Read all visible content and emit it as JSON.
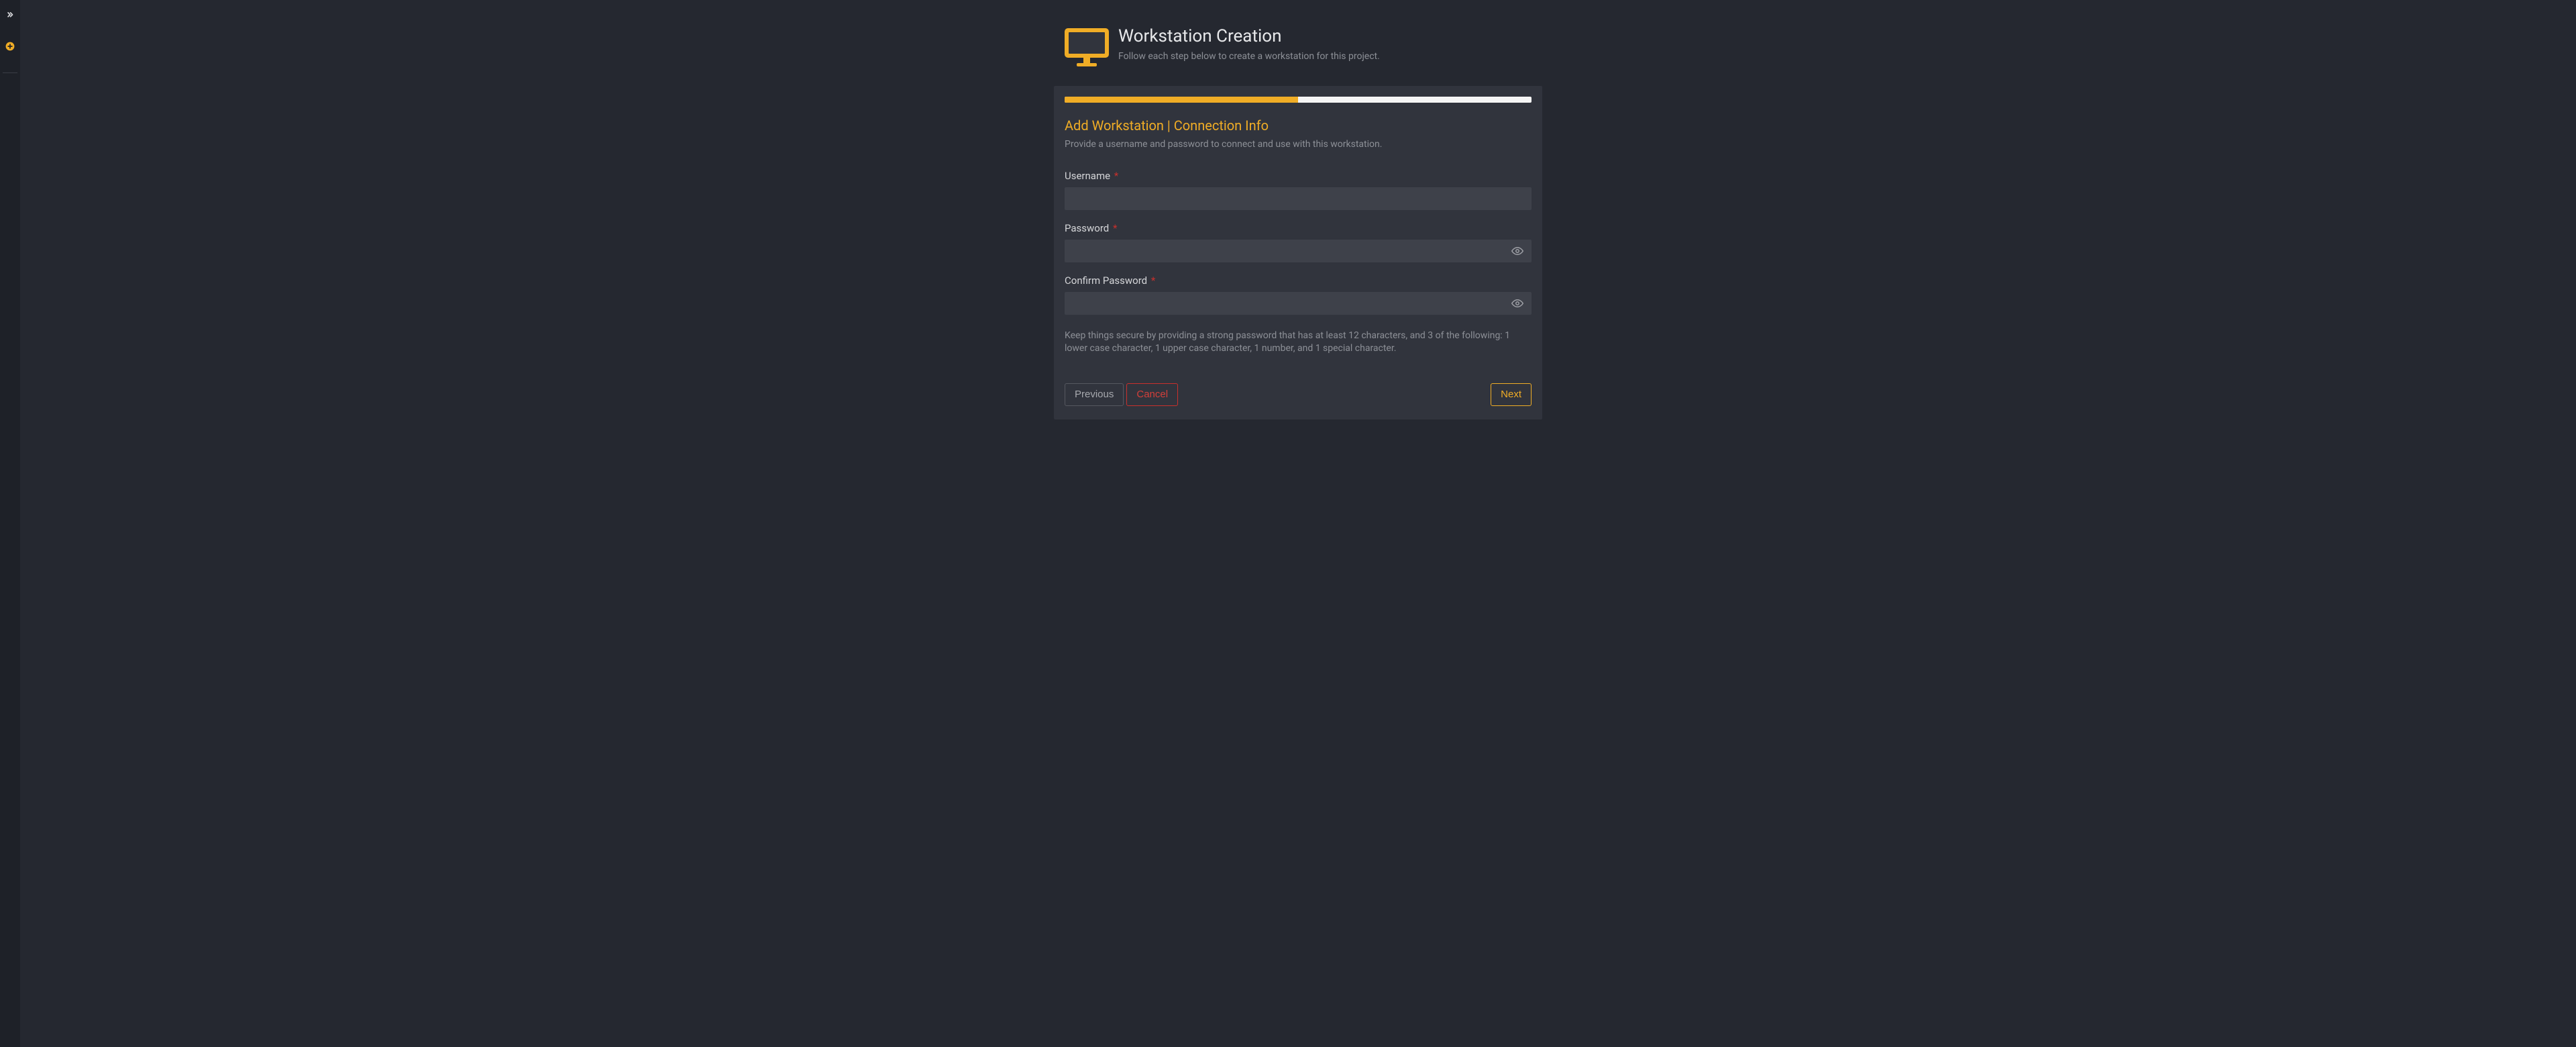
{
  "sidebar": {
    "expand_label": "expand",
    "add_label": "add"
  },
  "header": {
    "title": "Workstation Creation",
    "subtitle": "Follow each step below to create a workstation for this project."
  },
  "wizard": {
    "progress_percent": 50,
    "step_title": "Add Workstation | Connection Info",
    "step_subtitle": "Provide a username and password to connect and use with this workstation.",
    "helper_text": "Keep things secure by providing a strong password that has at least 12 characters, and 3 of the following: 1 lower case character, 1 upper case character, 1 number, and 1 special character."
  },
  "fields": {
    "username": {
      "label": "Username",
      "value": ""
    },
    "password": {
      "label": "Password",
      "value": ""
    },
    "confirm_password": {
      "label": "Confirm Password",
      "value": ""
    }
  },
  "required_marker": "*",
  "buttons": {
    "previous": "Previous",
    "cancel": "Cancel",
    "next": "Next"
  },
  "colors": {
    "accent": "#f0ad26",
    "danger": "#c9302c",
    "bg": "#252830",
    "panel": "#31343d"
  }
}
